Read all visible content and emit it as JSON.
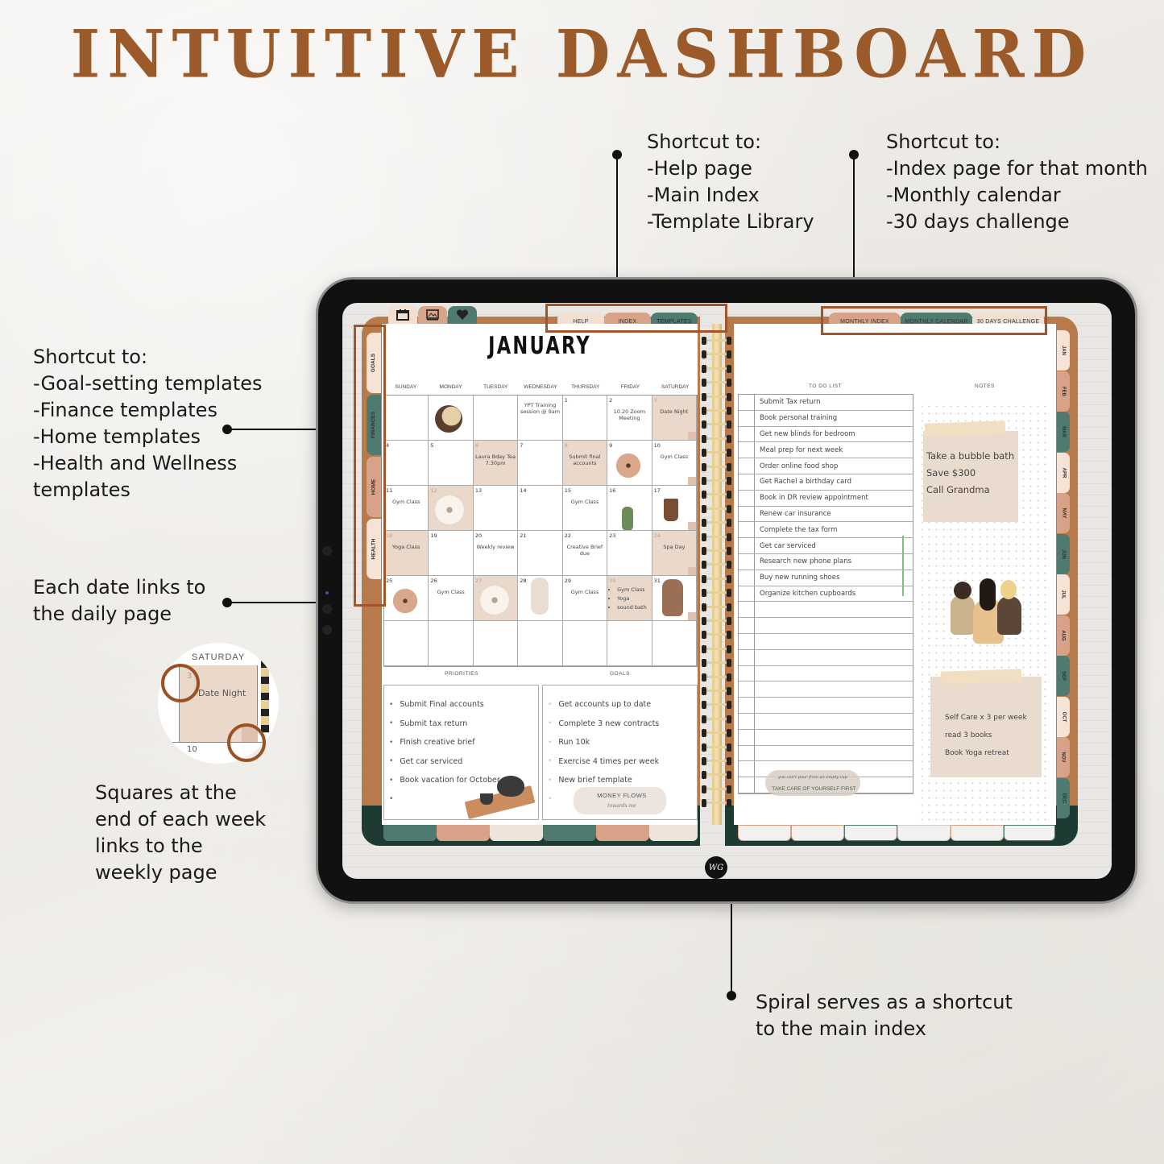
{
  "page_title": "INTUITIVE DASHBOARD",
  "callouts": {
    "top_center": [
      "Shortcut to:",
      "-Help page",
      "-Main Index",
      "-Template Library"
    ],
    "top_right": [
      "Shortcut to:",
      "-Index page for that month",
      "-Monthly calendar",
      "-30 days challenge"
    ],
    "left_tabs": [
      "Shortcut to:",
      "-Goal-setting templates",
      "-Finance templates",
      "-Home templates",
      "-Health and Wellness",
      "templates"
    ],
    "dates": [
      "Each date links to",
      "the daily page"
    ],
    "weekly": [
      "Squares at the",
      "end of each week",
      "links to the",
      "weekly page"
    ],
    "spiral": [
      "Spiral serves as a shortcut",
      "to the main index"
    ]
  },
  "zoom_example": {
    "day": "SATURDAY",
    "date": "3",
    "event": "Date Night",
    "next_date": "10"
  },
  "planner": {
    "icon_tabs": [
      {
        "icon": "calendar-icon",
        "color": "#f2dfd0"
      },
      {
        "icon": "picture-frame-icon",
        "color": "#d7a58a"
      },
      {
        "icon": "heart-icon",
        "color": "#4e7a6f"
      }
    ],
    "top_tabs": [
      {
        "label": "HELP",
        "color": "#f1e0d1"
      },
      {
        "label": "INDEX",
        "color": "#d8a288"
      },
      {
        "label": "TEMPLATES",
        "color": "#4e7a6f"
      }
    ],
    "right_top_tabs": [
      {
        "label": "MONTHLY INDEX",
        "color": "#d8a288"
      },
      {
        "label": "MONTHLY CALENDAR",
        "color": "#4e7a6f"
      },
      {
        "label": "30 DAYS CHALLENGE",
        "color": "#f1e0d1"
      }
    ],
    "side_tabs": [
      {
        "label": "GOALS",
        "color": "#f5e3d6"
      },
      {
        "label": "FINANCES",
        "color": "#4e7a6f"
      },
      {
        "label": "HOME",
        "color": "#d8a288"
      },
      {
        "label": "HEALTH",
        "color": "#f5e3d6"
      }
    ],
    "month_tabs": [
      {
        "label": "JAN",
        "color": "#f5e3d6"
      },
      {
        "label": "FEB",
        "color": "#d8a288"
      },
      {
        "label": "MAR",
        "color": "#4e7a6f"
      },
      {
        "label": "APR",
        "color": "#f5e3d6"
      },
      {
        "label": "MAY",
        "color": "#d8a288"
      },
      {
        "label": "JUN",
        "color": "#4e7a6f"
      },
      {
        "label": "JUL",
        "color": "#f5e3d6"
      },
      {
        "label": "AUG",
        "color": "#d8a288"
      },
      {
        "label": "SEP",
        "color": "#4e7a6f"
      },
      {
        "label": "OCT",
        "color": "#f5e3d6"
      },
      {
        "label": "NOV",
        "color": "#d8a288"
      },
      {
        "label": "DEC",
        "color": "#4e7a6f"
      }
    ],
    "month": "JANUARY",
    "weekdays": [
      "SUNDAY",
      "MONDAY",
      "TUESDAY",
      "WEDNESDAY",
      "THURSDAY",
      "FRIDAY",
      "SATURDAY"
    ],
    "cells": [
      {
        "num": "",
        "event": "",
        "shade": false
      },
      {
        "num": "",
        "event": "",
        "shade": false,
        "deco": "compact-mirror"
      },
      {
        "num": "",
        "event": "",
        "shade": false
      },
      {
        "num": "",
        "event": "YPT Training session @ 9am",
        "shade": false
      },
      {
        "num": "1",
        "event": "",
        "shade": false
      },
      {
        "num": "2",
        "event": "10.20 Zoom Meeting",
        "shade": false
      },
      {
        "num": "3",
        "event": "Date Night",
        "shade": true,
        "week": true
      },
      {
        "num": "4",
        "event": "",
        "shade": false
      },
      {
        "num": "5",
        "event": "",
        "shade": false
      },
      {
        "num": "6",
        "event": "Laura Bday Tea 7.30pm",
        "shade": true
      },
      {
        "num": "7",
        "event": "",
        "shade": false
      },
      {
        "num": "8",
        "event": "Submit final accounts",
        "shade": true
      },
      {
        "num": "9",
        "event": "",
        "shade": false,
        "deco": "flower"
      },
      {
        "num": "10",
        "event": "Gym Class",
        "shade": false,
        "week": true
      },
      {
        "num": "11",
        "event": "Gym Class",
        "shade": false
      },
      {
        "num": "12",
        "event": "",
        "shade": true,
        "deco": "white-flower"
      },
      {
        "num": "13",
        "event": "",
        "shade": false
      },
      {
        "num": "14",
        "event": "",
        "shade": false
      },
      {
        "num": "15",
        "event": "Gym Class",
        "shade": false
      },
      {
        "num": "16",
        "event": "",
        "shade": false,
        "deco": "plant"
      },
      {
        "num": "17",
        "event": "",
        "shade": false,
        "deco": "coffee",
        "week": true
      },
      {
        "num": "18",
        "event": "Yoga Class",
        "shade": true
      },
      {
        "num": "19",
        "event": "",
        "shade": false
      },
      {
        "num": "20",
        "event": "Weekly review",
        "shade": false
      },
      {
        "num": "21",
        "event": "",
        "shade": false
      },
      {
        "num": "22",
        "event": "Creative Brief due",
        "shade": false
      },
      {
        "num": "23",
        "event": "",
        "shade": false
      },
      {
        "num": "24",
        "event": "Spa Day",
        "shade": true,
        "week": true
      },
      {
        "num": "25",
        "event": "",
        "shade": false,
        "deco": "flower"
      },
      {
        "num": "26",
        "event": "Gym Class",
        "shade": false
      },
      {
        "num": "27",
        "event": "",
        "shade": true,
        "deco": "white-flower"
      },
      {
        "num": "28",
        "event": "",
        "shade": false,
        "deco": "woman"
      },
      {
        "num": "29",
        "event": "Gym Class",
        "shade": false
      },
      {
        "num": "30",
        "event": "",
        "list": [
          "Gym Class",
          "Yoga",
          "sound bath"
        ],
        "shade": true
      },
      {
        "num": "31",
        "event": "",
        "shade": false,
        "deco": "bottle",
        "week": true
      },
      {
        "num": "",
        "event": "",
        "shade": false
      },
      {
        "num": "",
        "event": "",
        "shade": false
      },
      {
        "num": "",
        "event": "",
        "shade": false
      },
      {
        "num": "",
        "event": "",
        "shade": false
      },
      {
        "num": "",
        "event": "",
        "shade": false
      },
      {
        "num": "",
        "event": "",
        "shade": false
      },
      {
        "num": "",
        "event": "",
        "shade": false
      }
    ],
    "priorities": {
      "title": "PRIORITIES",
      "items": [
        "Submit Final accounts",
        "Submit tax return",
        "Finish creative brief",
        "Get car serviced",
        "Book vacation for October",
        ""
      ]
    },
    "goals": {
      "title": "GOALS",
      "items": [
        "Get accounts up to date",
        "Complete 3 new contracts",
        "Run 10k",
        "Exercise 4 times per week",
        "New brief template",
        ""
      ],
      "quote": "MONEY FLOWS",
      "quote_sub": "towards me"
    },
    "todo": {
      "title": "TO DO LIST",
      "items": [
        "Submit Tax return",
        "Book personal training",
        "Get new blinds for bedroom",
        "Meal prep for next week",
        "Order online food shop",
        "Get Rachel a birthday card",
        "Book in DR review appointment",
        "Renew car insurance",
        "Complete the tax form",
        "Get car serviced",
        "Research new phone plans",
        "Buy new running shoes",
        "Organize kitchen cupboards",
        "",
        "",
        "",
        "",
        "",
        "",
        "",
        "",
        "",
        "",
        "",
        ""
      ],
      "quote": "TAKE CARE OF YOURSELF FIRST",
      "quote_sub": "you can't pour from an empty cup"
    },
    "notes": {
      "title": "NOTES",
      "sticky1": [
        "Take a bubble bath",
        "Save $300",
        "Call Grandma"
      ],
      "sticky2": [
        "Self Care x 3 per week",
        "read 3 books",
        "Book Yoga retreat"
      ]
    },
    "logo": "WG"
  }
}
